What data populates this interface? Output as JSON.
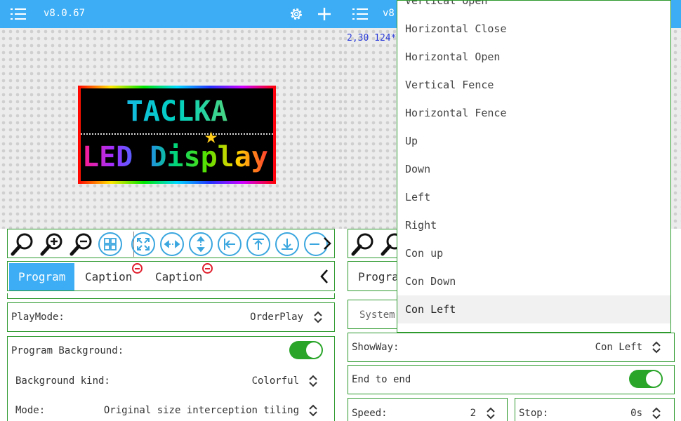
{
  "left": {
    "version": "v8.0.67",
    "canvas": {
      "led_line1": "TACLKA",
      "led_line2": "LED Display"
    },
    "tabs": [
      {
        "label": "Program",
        "active": true
      },
      {
        "label": "Caption"
      },
      {
        "label": "Caption"
      }
    ],
    "playmode": {
      "label": "PlayMode:",
      "value": "OrderPlay"
    },
    "background": {
      "label": "Program Background:",
      "toggle_on": true,
      "kind_label": "Background kind:",
      "kind_value": "Colorful",
      "mode_label": "Mode:",
      "mode_value": "Original size interception tiling"
    }
  },
  "right": {
    "version": "v8.",
    "coords": "2,30 124*",
    "tab_partial": "Progra",
    "system_partial": "System",
    "showway": {
      "label": "ShowWay:",
      "value": "Con Left"
    },
    "end_to_end": {
      "label": "End to end",
      "toggle_on": true
    },
    "speed": {
      "label": "Speed:",
      "value": "2"
    },
    "stop": {
      "label": "Stop:",
      "value": "0s"
    }
  },
  "dropdown": {
    "items": [
      "Vertical Open",
      "Horizontal Close",
      "Horizontal Open",
      "Vertical Fence",
      "Horizontal Fence",
      "Up",
      "Down",
      "Left",
      "Right",
      "Con up",
      "Con Down",
      "Con Left"
    ],
    "selected": "Con Left"
  },
  "colors": {
    "header": "#3daef5",
    "border_green": "#2e9a2e",
    "toggle_green": "#2aa52a",
    "icon_blue": "#3aa6df",
    "badge_red": "#e0202e"
  }
}
